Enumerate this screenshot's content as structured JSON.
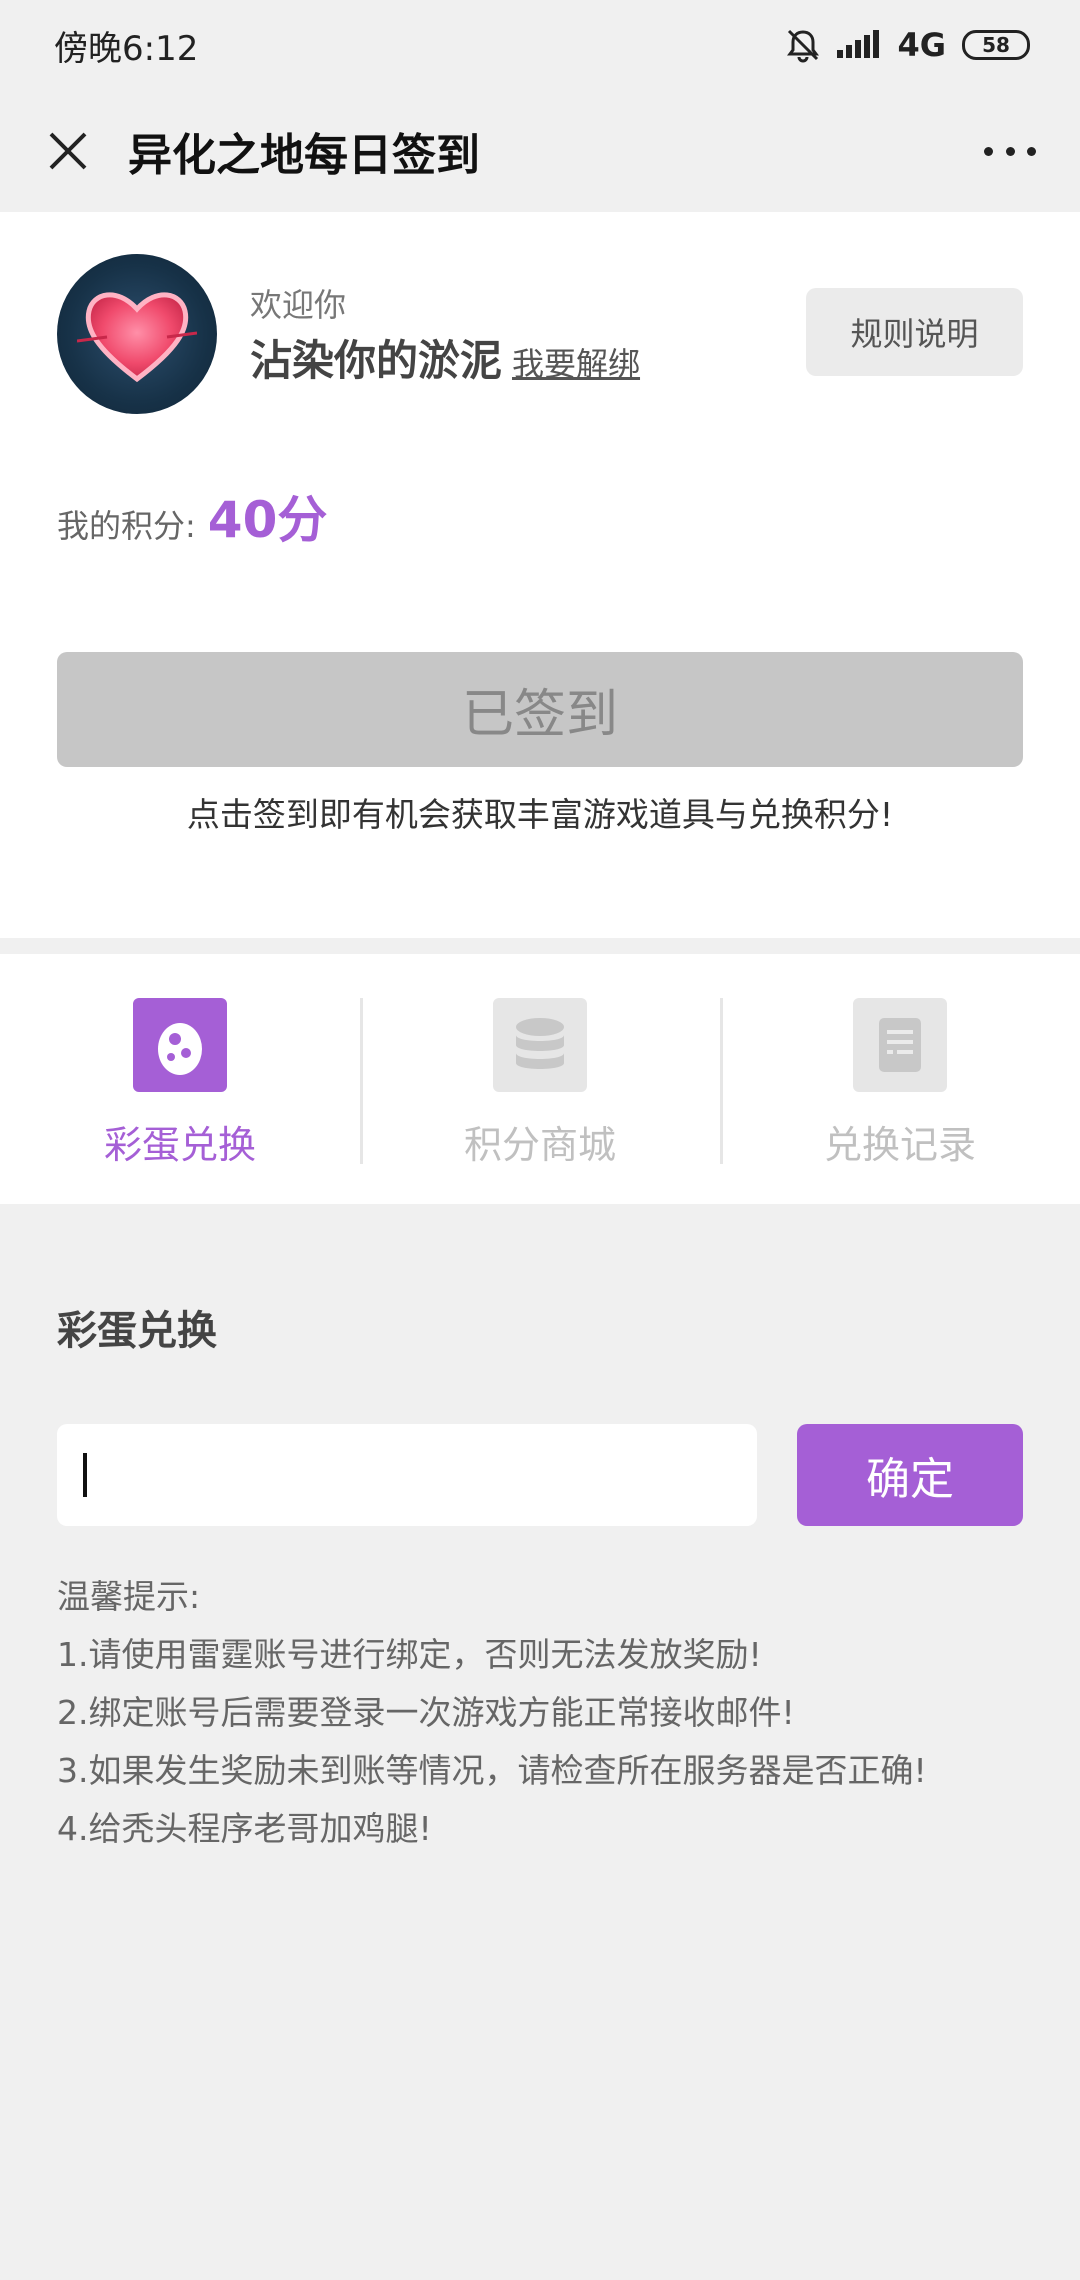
{
  "status_bar": {
    "time": "傍晚6:12",
    "network": "4G",
    "battery": "58"
  },
  "titlebar": {
    "title": "异化之地每日签到"
  },
  "profile": {
    "welcome": "欢迎你",
    "username": "沾染你的淤泥",
    "unbind_link": "我要解绑",
    "rules_button": "规则说明"
  },
  "points": {
    "label": "我的积分:",
    "value": "40分"
  },
  "signin": {
    "button_label": "已签到",
    "hint": "点击签到即有机会获取丰富游戏道具与兑换积分!"
  },
  "tabs": [
    {
      "label": "彩蛋兑换",
      "icon": "egg-icon",
      "active": true
    },
    {
      "label": "积分商城",
      "icon": "database-icon",
      "active": false
    },
    {
      "label": "兑换记录",
      "icon": "document-icon",
      "active": false
    }
  ],
  "exchange": {
    "section_title": "彩蛋兑换",
    "input_value": "",
    "confirm_button": "确定",
    "tips_title": "温馨提示:",
    "tips": [
      "1.请使用雷霆账号进行绑定，否则无法发放奖励!",
      "2.绑定账号后需要登录一次游戏方能正常接收邮件!",
      "3.如果发生奖励未到账等情况，请检查所在服务器是否正确!",
      "4.给秃头程序老哥加鸡腿!"
    ]
  },
  "colors": {
    "accent": "#a55fd6",
    "signed_button_bg": "#c6c6c6",
    "page_bg": "#f0f0f0"
  }
}
